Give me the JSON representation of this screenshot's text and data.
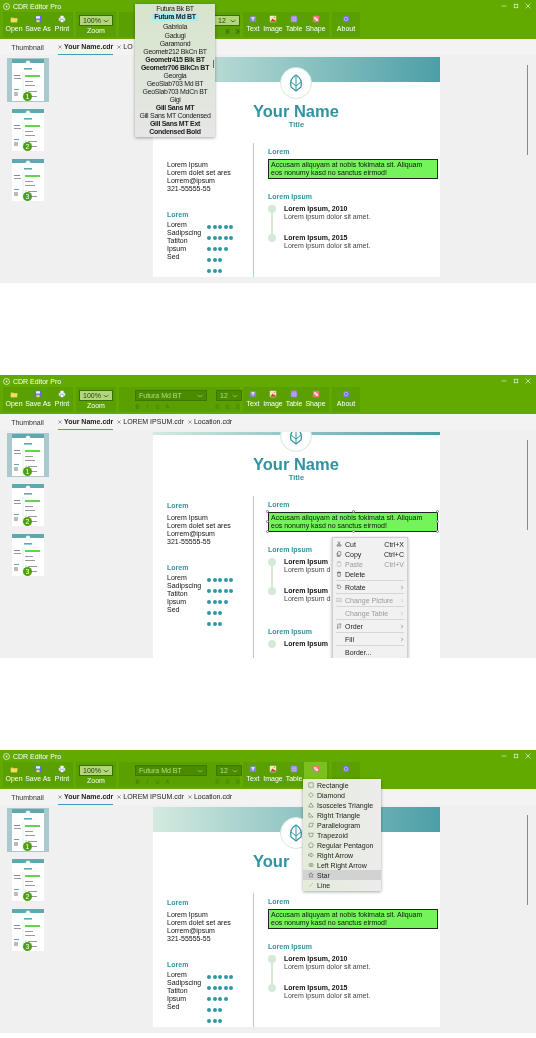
{
  "screens": [
    {
      "window": {
        "title": "CDR Editor Pro"
      },
      "ribbon": {
        "file_buttons": [
          {
            "label": "Open"
          },
          {
            "label": "Save As"
          },
          {
            "label": "Print"
          }
        ],
        "zoom": {
          "value": "100%",
          "label": "Zoom"
        },
        "font": {
          "disabled": false,
          "size": "12"
        },
        "insert_buttons": [
          {
            "label": "Text"
          },
          {
            "label": "Image"
          },
          {
            "label": "Table"
          },
          {
            "label": "Shape"
          }
        ],
        "about": {
          "label": "About"
        }
      },
      "tabs": {
        "panel_title": "Thumbnail",
        "documents": [
          {
            "label": "Your Name.cdr",
            "selected": true
          },
          {
            "label": "LO",
            "selected": false
          }
        ]
      },
      "thumbnails": [
        {
          "number": "1",
          "selected": true
        },
        {
          "number": "2",
          "selected": false
        },
        {
          "number": "3",
          "selected": false
        }
      ],
      "document": {
        "name": "Your Name",
        "title": "Title",
        "left": {
          "contact_lines": [
            "Lorem Ipsum",
            "Lorem dolet set ares",
            "Lorrem@ipsum",
            "321-55555-55"
          ],
          "skills_heading": "Lorem",
          "skills": [
            "Lorem",
            "Sadipscing",
            "Tatiton",
            "Ipsum",
            "Sed"
          ],
          "skill_ratings": [
            {
              "stars": 5
            },
            {
              "stars": 5
            },
            {
              "stars": 4
            },
            {
              "stars": 3
            },
            {
              "stars": 3
            }
          ]
        },
        "right": [
          {
            "kind": "highlight",
            "heading": "Lorem",
            "text": "Accusam aliquyam at nobis fokimata sit. Aliquam eos nonumy kasd no sanctus eirmod!",
            "selected": false
          },
          {
            "kind": "timeline",
            "heading": "Lorem Ipsum",
            "entries": [
              {
                "title": "Lorem Ipsum, 2010",
                "text": "Lorem ipsum dolor sit amet."
              },
              {
                "title": "Lorem Ipsum, 2015",
                "text": "Lorem ipsum dolor sit amet."
              }
            ]
          }
        ]
      },
      "popup": {
        "kind": "font_list",
        "items": [
          {
            "label": "Futura Bk BT",
            "bold": false,
            "selected": false
          },
          {
            "label": "Futura Md BT",
            "bold": true,
            "selected": true
          },
          {
            "label": "Gabriola",
            "bold": false,
            "selected": false
          },
          {
            "label": "Gadugi",
            "bold": false,
            "selected": false
          },
          {
            "label": "Garamond",
            "bold": false,
            "selected": false
          },
          {
            "label": "Geometr212 BkCn BT",
            "bold": false,
            "selected": false
          },
          {
            "label": "Geometr415 Blk BT",
            "bold": true,
            "selected": false
          },
          {
            "label": "Geometr706 BlkCn BT",
            "bold": true,
            "selected": false
          },
          {
            "label": "Georgia",
            "bold": false,
            "selected": false
          },
          {
            "label": "GeoSlab703 Md BT",
            "bold": false,
            "selected": false
          },
          {
            "label": "GeoSlab703 MdCn BT",
            "bold": false,
            "selected": false
          },
          {
            "label": "Gigi",
            "bold": false,
            "selected": false
          },
          {
            "label": "Gill Sans MT",
            "bold": true,
            "selected": false
          },
          {
            "label": "Gill Sans MT Condensed",
            "bold": false,
            "selected": false
          },
          {
            "label": "Gill Sans MT Ext Condensed Bold",
            "bold": true,
            "selected": false
          }
        ]
      }
    },
    {
      "window": {
        "title": "CDR Editor Pro"
      },
      "ribbon": {
        "file_buttons": [
          {
            "label": "Open"
          },
          {
            "label": "Save As"
          },
          {
            "label": "Print"
          }
        ],
        "zoom": {
          "value": "100%",
          "label": "Zoom"
        },
        "font": {
          "disabled": true,
          "name": "Futura Md BT",
          "size": "12"
        },
        "insert_buttons": [
          {
            "label": "Text"
          },
          {
            "label": "Image"
          },
          {
            "label": "Table"
          },
          {
            "label": "Shape"
          }
        ],
        "about": {
          "label": "About"
        }
      },
      "tabs": {
        "panel_title": "Thumbnail",
        "documents": [
          {
            "label": "Your Name.cdr",
            "selected": true
          },
          {
            "label": "LOREM IPSUM.cdr",
            "selected": false
          },
          {
            "label": "Location.cdr",
            "selected": false
          }
        ]
      },
      "thumbnails": [
        {
          "number": "1",
          "selected": true
        },
        {
          "number": "2",
          "selected": false
        },
        {
          "number": "3",
          "selected": false
        }
      ],
      "document": {
        "name": "Your Name",
        "title": "Title",
        "left": {
          "contact_heading": "Lorem",
          "contact_lines": [
            "Lorem Ipsum",
            "Lorem dolet set ares",
            "Lorrem@ipsum",
            "321-55555-55"
          ],
          "skills_heading": "Lorem",
          "skills": [
            "Lorem",
            "Sadipscing",
            "Tatiton",
            "Ipsum",
            "Sed"
          ],
          "skill_ratings": [
            {
              "stars": 5
            },
            {
              "stars": 5
            },
            {
              "stars": 4
            },
            {
              "stars": 3
            },
            {
              "stars": 3
            }
          ]
        },
        "right": [
          {
            "kind": "highlight",
            "heading": "Lorem",
            "text": "Accusam aliquyam at nobis fokimata sit. Aliquam eos nonumy kasd no sanctus eirmod!",
            "selected": true
          },
          {
            "kind": "timeline",
            "heading": "Lorem Ipsum",
            "entries": [
              {
                "title": "Lorem Ipsum",
                "text": "Lorem ipsum d"
              },
              {
                "title": "Lorem Ipsum",
                "text": "Lorem ipsum d"
              }
            ]
          },
          {
            "kind": "timeline",
            "heading": "Lorem Ipsum",
            "entries": [
              {
                "title": "Lorem Ipsum"
              }
            ]
          }
        ]
      },
      "popup": {
        "kind": "context_menu",
        "items": [
          {
            "kind": "item",
            "label": "Cut",
            "shortcut": "Ctrl+X",
            "disabled": false,
            "submenu": false
          },
          {
            "kind": "item",
            "label": "Copy",
            "shortcut": "Ctrl+C",
            "disabled": false,
            "submenu": false
          },
          {
            "kind": "item",
            "label": "Paste",
            "shortcut": "Ctrl+V",
            "disabled": true,
            "submenu": false
          },
          {
            "kind": "item",
            "label": "Delete",
            "disabled": false,
            "submenu": false
          },
          {
            "kind": "separator"
          },
          {
            "kind": "item",
            "label": "Rotate",
            "disabled": false,
            "submenu": true
          },
          {
            "kind": "separator"
          },
          {
            "kind": "item",
            "label": "Change Picture",
            "disabled": true,
            "submenu": true
          },
          {
            "kind": "separator"
          },
          {
            "kind": "item",
            "label": "Change Table",
            "disabled": true,
            "submenu": true
          },
          {
            "kind": "separator"
          },
          {
            "kind": "item",
            "label": "Order",
            "disabled": false,
            "submenu": true
          },
          {
            "kind": "separator"
          },
          {
            "kind": "item",
            "label": "Fill",
            "disabled": false,
            "submenu": true
          },
          {
            "kind": "separator"
          },
          {
            "kind": "item",
            "label": "Border...",
            "disabled": false,
            "submenu": false
          }
        ]
      }
    },
    {
      "window": {
        "title": "CDR Editor Pro"
      },
      "ribbon": {
        "file_buttons": [
          {
            "label": "Open"
          },
          {
            "label": "Save As"
          },
          {
            "label": "Print"
          }
        ],
        "zoom": {
          "value": "100%",
          "label": "Zoom"
        },
        "font": {
          "disabled": true,
          "name": "Futura Md BT",
          "size": "12"
        },
        "insert_buttons": [
          {
            "label": "Text",
            "expanded": false
          },
          {
            "label": "Image",
            "expanded": false
          },
          {
            "label": "Table",
            "expanded": false
          },
          {
            "expanded": true
          }
        ]
      },
      "tabs": {
        "panel_title": "Thumbnail",
        "documents": [
          {
            "label": "Your Name.cdr",
            "selected": true
          },
          {
            "label": "LOREM IPSUM.cdr",
            "selected": false
          },
          {
            "label": "Location.cdr",
            "selected": false
          }
        ]
      },
      "thumbnails": [
        {
          "number": "1",
          "selected": true
        },
        {
          "number": "2",
          "selected": false
        },
        {
          "number": "3",
          "selected": false
        }
      ],
      "document": {
        "name": "Your",
        "left": {
          "contact_heading": "Lorem",
          "contact_lines": [
            "Lorem Ipsum",
            "Lorem dolet set ares",
            "Lorrem@ipsum",
            "321-55555-55"
          ],
          "skills_heading": "Lorem",
          "skills": [
            "Lorem",
            "Sadipscing",
            "Tatiton",
            "Ipsum",
            "Sed"
          ],
          "skill_ratings": [
            {
              "stars": 5
            },
            {
              "stars": 5
            },
            {
              "stars": 4
            },
            {
              "stars": 3
            },
            {
              "stars": 3
            }
          ]
        },
        "right": [
          {
            "kind": "highlight",
            "heading": "Lorem",
            "text": "Accusam aliquyam at nobis fokimata sit. Aliquam eos nonumy kasd no sanctus eirmod!",
            "selected": false
          },
          {
            "kind": "timeline",
            "heading": "Lorem Ipsum",
            "entries": [
              {
                "title": "Lorem Ipsum, 2010",
                "text": "Lorem ipsum dolor sit amet."
              },
              {
                "title": "Lorem Ipsum, 2015",
                "text": "Lorem ipsum dolor sit amet."
              }
            ]
          }
        ]
      },
      "popup": {
        "kind": "shape_menu",
        "items": [
          {
            "label": "Rectangle",
            "selected": false
          },
          {
            "label": "Diamond",
            "selected": false
          },
          {
            "label": "Isosceles Triangle",
            "selected": false
          },
          {
            "label": "Right Triangle",
            "selected": false
          },
          {
            "label": "Parallelogram",
            "selected": false
          },
          {
            "label": "Trapezoid",
            "selected": false
          },
          {
            "label": "Regular Pentagon",
            "selected": false
          },
          {
            "label": "Right Arrow",
            "selected": false
          },
          {
            "label": "Left Right Arrow",
            "selected": false
          },
          {
            "label": "Star",
            "selected": true
          },
          {
            "label": "Line",
            "selected": false
          }
        ]
      }
    }
  ]
}
